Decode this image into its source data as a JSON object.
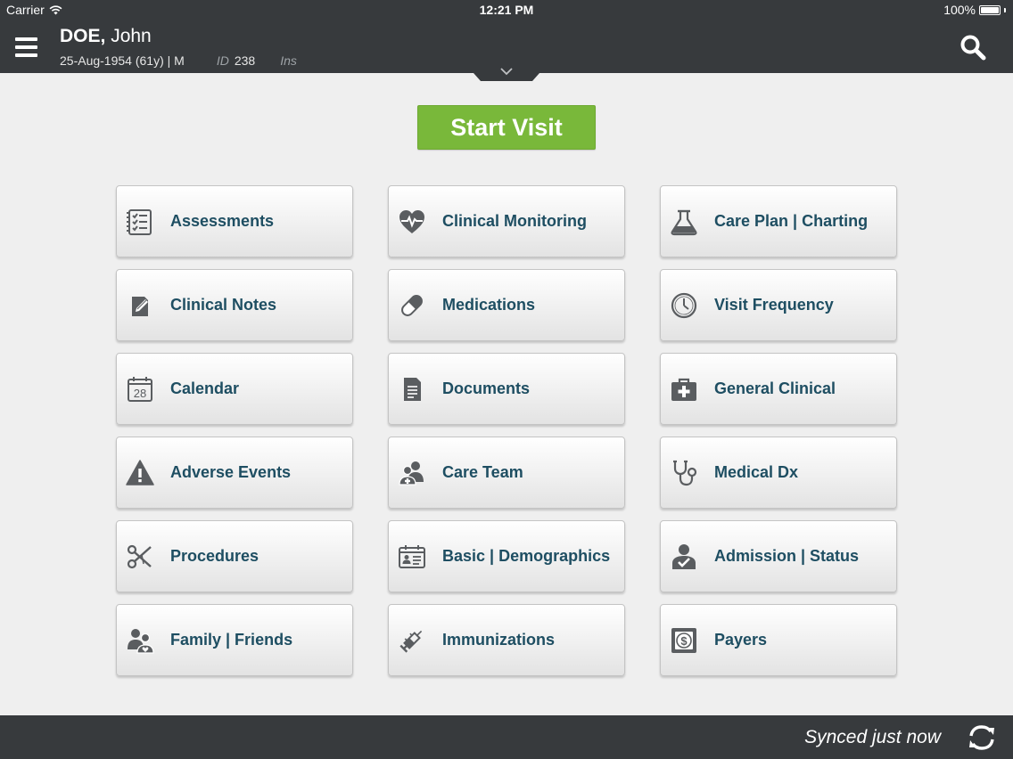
{
  "status_bar": {
    "carrier": "Carrier",
    "time": "12:21 PM",
    "battery": "100%",
    "battery_level": 1.0
  },
  "header": {
    "last_name": "DOE,",
    "first_name": "John",
    "dob_line": "25-Aug-1954 (61y) | M",
    "id_label": "ID",
    "id_value": "238",
    "ins_label": "Ins"
  },
  "start_visit_label": "Start Visit",
  "tiles": [
    {
      "label": "Assessments",
      "icon": "clipboard-checklist-icon"
    },
    {
      "label": "Clinical Monitoring",
      "icon": "heart-pulse-icon"
    },
    {
      "label": "Care Plan | Charting",
      "icon": "flask-icon"
    },
    {
      "label": "Clinical Notes",
      "icon": "note-pencil-icon"
    },
    {
      "label": "Medications",
      "icon": "pill-icon"
    },
    {
      "label": "Visit Frequency",
      "icon": "clock-icon"
    },
    {
      "label": "Calendar",
      "icon": "calendar-icon",
      "icon_text": "28"
    },
    {
      "label": "Documents",
      "icon": "document-icon"
    },
    {
      "label": "General Clinical",
      "icon": "medical-kit-icon"
    },
    {
      "label": "Adverse Events",
      "icon": "warning-icon"
    },
    {
      "label": "Care Team",
      "icon": "care-team-icon"
    },
    {
      "label": "Medical Dx",
      "icon": "stethoscope-icon"
    },
    {
      "label": "Procedures",
      "icon": "scissors-icon"
    },
    {
      "label": "Basic | Demographics",
      "icon": "id-card-icon"
    },
    {
      "label": "Admission | Status",
      "icon": "person-check-icon"
    },
    {
      "label": "Family | Friends",
      "icon": "family-icon"
    },
    {
      "label": "Immunizations",
      "icon": "syringe-icon"
    },
    {
      "label": "Payers",
      "icon": "dollar-icon"
    }
  ],
  "footer": {
    "sync_text": "Synced just now"
  },
  "colors": {
    "bar": "#373a3d",
    "accent_green": "#79b83a",
    "tile_text": "#1e4e62",
    "icon_gray": "#5a5d60"
  }
}
